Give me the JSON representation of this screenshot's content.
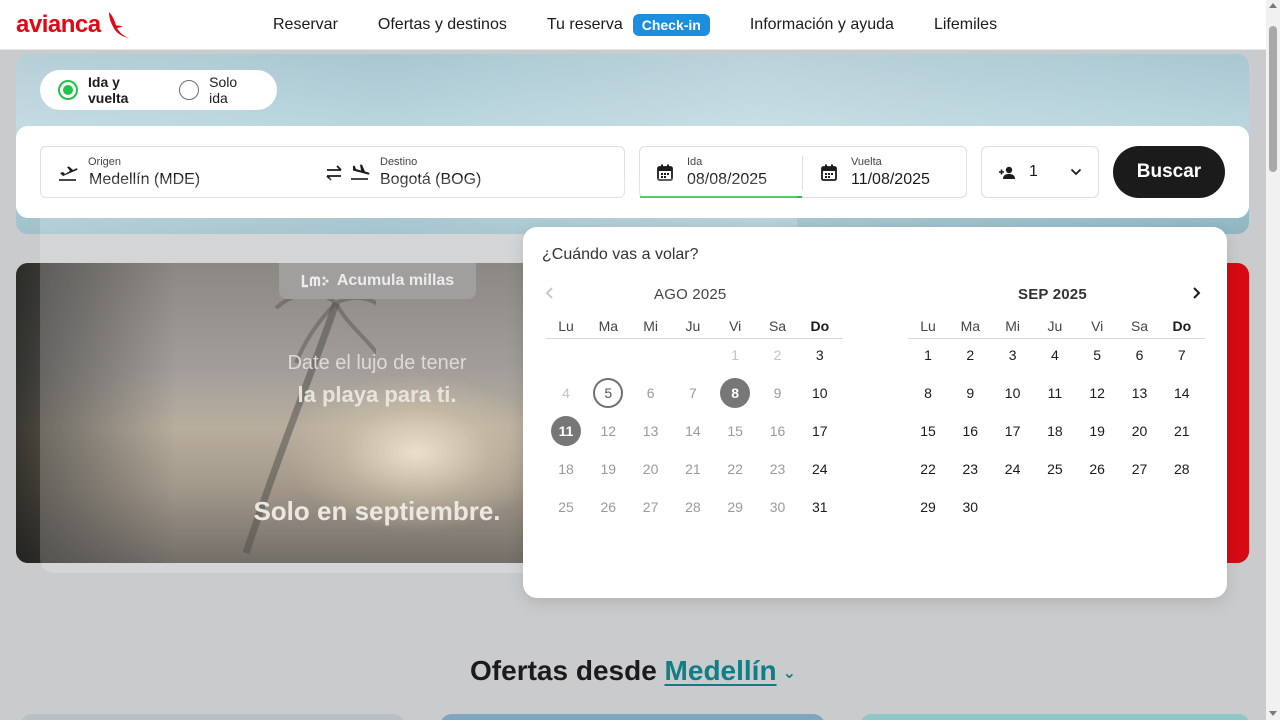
{
  "header": {
    "logo_text": "avianca",
    "nav": [
      {
        "label": "Reservar"
      },
      {
        "label": "Ofertas y destinos"
      },
      {
        "label": "Tu reserva"
      },
      {
        "label": "Información y ayuda"
      },
      {
        "label": "Lifemiles"
      }
    ],
    "checkin_badge": "Check-in"
  },
  "trip_type": {
    "options": [
      {
        "label": "Ida y vuelta",
        "selected": true
      },
      {
        "label": "Solo ida",
        "selected": false
      }
    ]
  },
  "search": {
    "origin_label": "Origen",
    "origin_value": "Medellín (MDE)",
    "destination_label": "Destino",
    "destination_value": "Bogotá (BOG)",
    "departure_label": "Ida",
    "departure_value": "08/08/2025",
    "return_label": "Vuelta",
    "return_value": "11/08/2025",
    "passengers": "1",
    "search_button": "Buscar"
  },
  "promo": {
    "miles_tag": "Acumula millas",
    "line1": "Date el lujo de tener",
    "line2": "la playa para ti.",
    "line3": "Solo en septiembre."
  },
  "calendar": {
    "question": "¿Cuándo vas a volar?",
    "weekdays": [
      "Lu",
      "Ma",
      "Mi",
      "Ju",
      "Vi",
      "Sa",
      "Do"
    ],
    "months": [
      {
        "title": "AGO 2025"
      },
      {
        "title": "SEP 2025"
      }
    ],
    "aug_weeks": [
      [
        "",
        "",
        "",
        "",
        "1",
        "2",
        "3"
      ],
      [
        "4",
        "5",
        "6",
        "7",
        "8",
        "9",
        "10"
      ],
      [
        "11",
        "12",
        "13",
        "14",
        "15",
        "16",
        "17"
      ],
      [
        "18",
        "19",
        "20",
        "21",
        "22",
        "23",
        "24"
      ],
      [
        "25",
        "26",
        "27",
        "28",
        "29",
        "30",
        "31"
      ]
    ],
    "sep_weeks": [
      [
        "1",
        "2",
        "3",
        "4",
        "5",
        "6",
        "7"
      ],
      [
        "8",
        "9",
        "10",
        "11",
        "12",
        "13",
        "14"
      ],
      [
        "15",
        "16",
        "17",
        "18",
        "19",
        "20",
        "21"
      ],
      [
        "22",
        "23",
        "24",
        "25",
        "26",
        "27",
        "28"
      ],
      [
        "29",
        "30",
        "",
        "",
        "",
        "",
        ""
      ]
    ],
    "today": "5",
    "selected_departure": "8",
    "selected_return": "11"
  },
  "offers": {
    "prefix": "Ofertas desde",
    "city": "Medellín"
  },
  "colors": {
    "brand_red": "#e30613",
    "checkin_blue": "#1b8ee0",
    "accent_green": "#24c24a",
    "link_teal": "#0f7e86"
  }
}
